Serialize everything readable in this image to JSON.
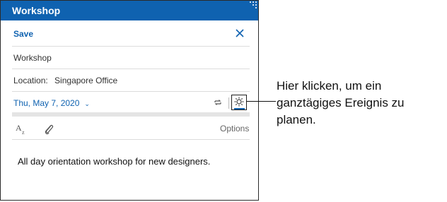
{
  "window": {
    "title": "Workshop"
  },
  "toolbar": {
    "save_label": "Save"
  },
  "event": {
    "title": "Workshop",
    "location_label": "Location:",
    "location_value": "Singapore Office",
    "date": "Thu, May 7, 2020",
    "body": "All day orientation workshop for new designers."
  },
  "format_bar": {
    "options_label": "Options"
  },
  "annotation": {
    "callout_text": "Hier klicken, um ein ganztägiges Ereignis zu planen."
  },
  "colors": {
    "accent": "#0f62b0",
    "title_bar": "#0f62b0",
    "divider": "#dcdcdc"
  },
  "icons": [
    "close-icon",
    "chevron-down-icon",
    "repeat-icon",
    "sun-icon",
    "format-text-icon",
    "paperclip-icon"
  ]
}
